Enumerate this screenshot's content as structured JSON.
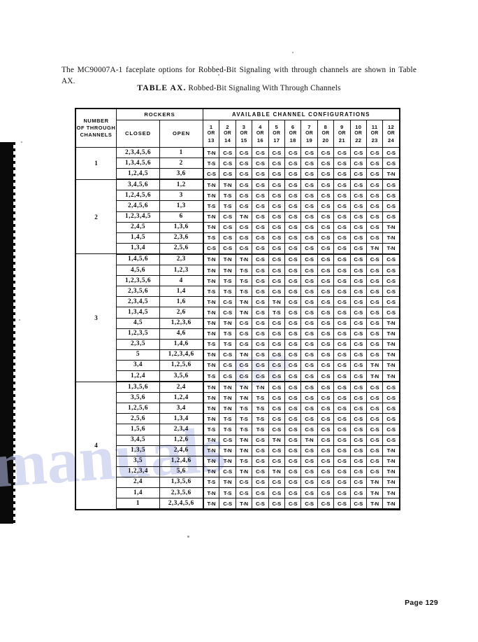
{
  "intro": {
    "text": "The MC90007A-1 faceplate options for Robbed-Bit Signaling with through channels are shown in Table AX."
  },
  "caption": {
    "label": "TABLE AX.",
    "text": "Robbed-Bit Signaling With Through Channels"
  },
  "table": {
    "headers": {
      "number_of_through_channels": "NUMBER OF THROUGH CHANNELS",
      "number_line1": "NUMBER",
      "number_line2": "OF  THROUGH",
      "number_line3": "CHANNELS",
      "rockers": "ROCKERS",
      "closed": "CLOSED",
      "open": "OPEN",
      "available_channel_configurations": "AVAILABLE CHANNEL CONFIGURATIONS",
      "or": "OR",
      "config_columns": [
        {
          "top": "1",
          "bottom": "13"
        },
        {
          "top": "2",
          "bottom": "14"
        },
        {
          "top": "3",
          "bottom": "15"
        },
        {
          "top": "4",
          "bottom": "16"
        },
        {
          "top": "5",
          "bottom": "17"
        },
        {
          "top": "6",
          "bottom": "18"
        },
        {
          "top": "7",
          "bottom": "19"
        },
        {
          "top": "8",
          "bottom": "20"
        },
        {
          "top": "9",
          "bottom": "21"
        },
        {
          "top": "10",
          "bottom": "22"
        },
        {
          "top": "11",
          "bottom": "23"
        },
        {
          "top": "12",
          "bottom": "24"
        }
      ]
    },
    "groups": [
      {
        "channels": "1",
        "rows": [
          {
            "closed": "2,3,4,5,6",
            "open": "1",
            "cfg": [
              "T-N",
              "C-S",
              "C-S",
              "C-S",
              "C-S",
              "C-S",
              "C-S",
              "C-S",
              "C-S",
              "C-S",
              "C-S",
              "C-S"
            ]
          },
          {
            "closed": "1,3,4,5,6",
            "open": "2",
            "cfg": [
              "T-S",
              "C-S",
              "C-S",
              "C-S",
              "C-S",
              "C-S",
              "C-S",
              "C-S",
              "C-S",
              "C-S",
              "C-S",
              "C-S"
            ]
          },
          {
            "closed": "1,2,4,5",
            "open": "3,6",
            "cfg": [
              "C-S",
              "C-S",
              "C-S",
              "C-S",
              "C-S",
              "C-S",
              "C-S",
              "C-S",
              "C-S",
              "C-S",
              "C-S",
              "T-N"
            ]
          }
        ]
      },
      {
        "channels": "2",
        "rows": [
          {
            "closed": "3,4,5,6",
            "open": "1,2",
            "cfg": [
              "T-N",
              "T-N",
              "C-S",
              "C-S",
              "C-S",
              "C-S",
              "C-S",
              "C-S",
              "C-S",
              "C-S",
              "C-S",
              "C-S"
            ]
          },
          {
            "closed": "1,2,4,5,6",
            "open": "3",
            "cfg": [
              "T-N",
              "T-S",
              "C-S",
              "C-S",
              "C-S",
              "C-S",
              "C-S",
              "C-S",
              "C-S",
              "C-S",
              "C-S",
              "C-S"
            ]
          },
          {
            "closed": "2,4,5,6",
            "open": "1,3",
            "cfg": [
              "T-S",
              "T-S",
              "C-S",
              "C-S",
              "C-S",
              "C-S",
              "C-S",
              "C-S",
              "C-S",
              "C-S",
              "C-S",
              "C-S"
            ]
          },
          {
            "closed": "1,2,3,4,5",
            "open": "6",
            "cfg": [
              "T-N",
              "C-S",
              "T-N",
              "C-S",
              "C-S",
              "C-S",
              "C-S",
              "C-S",
              "C-S",
              "C-S",
              "C-S",
              "C-S"
            ]
          },
          {
            "closed": "2,4,5",
            "open": "1,3,6",
            "cfg": [
              "T-N",
              "C-S",
              "C-S",
              "C-S",
              "C-S",
              "C-S",
              "C-S",
              "C-S",
              "C-S",
              "C-S",
              "C-S",
              "T-N"
            ]
          },
          {
            "closed": "1,4,5",
            "open": "2,3,6",
            "cfg": [
              "T-S",
              "C-S",
              "C-S",
              "C-S",
              "C-S",
              "C-S",
              "C-S",
              "C-S",
              "C-S",
              "C-S",
              "C-S",
              "T-N"
            ]
          },
          {
            "closed": "1,3,4",
            "open": "2,5,6",
            "cfg": [
              "C-S",
              "C-S",
              "C-S",
              "C-S",
              "C-S",
              "C-S",
              "C-S",
              "C-S",
              "C-S",
              "C-S",
              "T-N",
              "T-N"
            ]
          }
        ]
      },
      {
        "channels": "3",
        "rows": [
          {
            "closed": "1,4,5,6",
            "open": "2,3",
            "cfg": [
              "T-N",
              "T-N",
              "T-N",
              "C-S",
              "C-S",
              "C-S",
              "C-S",
              "C-S",
              "C-S",
              "C-S",
              "C-S",
              "C-S"
            ]
          },
          {
            "closed": "4,5,6",
            "open": "1,2,3",
            "cfg": [
              "T-N",
              "T-N",
              "T-S",
              "C-S",
              "C-S",
              "C-S",
              "C-S",
              "C-S",
              "C-S",
              "C-S",
              "C-S",
              "C-S"
            ]
          },
          {
            "closed": "1,2,3,5,6",
            "open": "4",
            "cfg": [
              "T-N",
              "T-S",
              "T-S",
              "C-S",
              "C-S",
              "C-S",
              "C-S",
              "C-S",
              "C-S",
              "C-S",
              "C-S",
              "C-S"
            ]
          },
          {
            "closed": "2,3,5,6",
            "open": "1,4",
            "cfg": [
              "T-S",
              "T-S",
              "T-S",
              "C-S",
              "C-S",
              "C-S",
              "C-S",
              "C-S",
              "C-S",
              "C-S",
              "C-S",
              "C-S"
            ]
          },
          {
            "closed": "2,3,4,5",
            "open": "1,6",
            "cfg": [
              "T-N",
              "C-S",
              "T-N",
              "C-S",
              "T-N",
              "C-S",
              "C-S",
              "C-S",
              "C-S",
              "C-S",
              "C-S",
              "C-S"
            ]
          },
          {
            "closed": "1,3,4,5",
            "open": "2,6",
            "cfg": [
              "T-N",
              "C-S",
              "T-N",
              "C-S",
              "T-S",
              "C-S",
              "C-S",
              "C-S",
              "C-S",
              "C-S",
              "C-S",
              "C-S"
            ]
          },
          {
            "closed": "4,5",
            "open": "1,2,3,6",
            "cfg": [
              "T-N",
              "T-N",
              "C-S",
              "C-S",
              "C-S",
              "C-S",
              "C-S",
              "C-S",
              "C-S",
              "C-S",
              "C-S",
              "T-N"
            ]
          },
          {
            "closed": "1,2,3,5",
            "open": "4,6",
            "cfg": [
              "T-N",
              "T-S",
              "C-S",
              "C-S",
              "C-S",
              "C-S",
              "C-S",
              "C-S",
              "C-S",
              "C-S",
              "C-S",
              "T-N"
            ]
          },
          {
            "closed": "2,3,5",
            "open": "1,4,6",
            "cfg": [
              "T-S",
              "T-S",
              "C-S",
              "C-S",
              "C-S",
              "C-S",
              "C-S",
              "C-S",
              "C-S",
              "C-S",
              "C-S",
              "T-N"
            ]
          },
          {
            "closed": "5",
            "open": "1,2,3,4,6",
            "cfg": [
              "T-N",
              "C-S",
              "T-N",
              "C-S",
              "C-S",
              "C-S",
              "C-S",
              "C-S",
              "C-S",
              "C-S",
              "C-S",
              "T-N"
            ]
          },
          {
            "closed": "3,4",
            "open": "1,2,5,6",
            "cfg": [
              "T-N",
              "C-S",
              "C-S",
              "C-S",
              "C-S",
              "C-S",
              "C-S",
              "C-S",
              "C-S",
              "C-S",
              "T-N",
              "T-N"
            ]
          },
          {
            "closed": "1,2,4",
            "open": "3,5,6",
            "cfg": [
              "T-S",
              "C-S",
              "C-S",
              "C-S",
              "C-S",
              "C-S",
              "C-S",
              "C-S",
              "C-S",
              "C-S",
              "T-N",
              "T-N"
            ]
          }
        ]
      },
      {
        "channels": "4",
        "rows": [
          {
            "closed": "1,3,5,6",
            "open": "2,4",
            "cfg": [
              "T-N",
              "T-N",
              "T-N",
              "T-N",
              "C-S",
              "C-S",
              "C-S",
              "C-S",
              "C-S",
              "C-S",
              "C-S",
              "C-S"
            ]
          },
          {
            "closed": "3,5,6",
            "open": "1,2,4",
            "cfg": [
              "T-N",
              "T-N",
              "T-N",
              "T-S",
              "C-S",
              "C-S",
              "C-S",
              "C-S",
              "C-S",
              "C-S",
              "C-S",
              "C-S"
            ]
          },
          {
            "closed": "1,2,5,6",
            "open": "3,4",
            "cfg": [
              "T-N",
              "T-N",
              "T-S",
              "T-S",
              "C-S",
              "C-S",
              "C-S",
              "C-S",
              "C-S",
              "C-S",
              "C-S",
              "C-S"
            ]
          },
          {
            "closed": "2,5,6",
            "open": "1,3,4",
            "cfg": [
              "T-N",
              "T-S",
              "T-S",
              "T-S",
              "C-S",
              "C-S",
              "C-S",
              "C-S",
              "C-S",
              "C-S",
              "C-S",
              "C-S"
            ]
          },
          {
            "closed": "1,5,6",
            "open": "2,3,4",
            "cfg": [
              "T-S",
              "T-S",
              "T-S",
              "T-S",
              "C-S",
              "C-S",
              "C-S",
              "C-S",
              "C-S",
              "C-S",
              "C-S",
              "C-S"
            ]
          },
          {
            "closed": "3,4,5",
            "open": "1,2,6",
            "cfg": [
              "T-N",
              "C-S",
              "T-N",
              "C-S",
              "T-N",
              "C-S",
              "T-N",
              "C-S",
              "C-S",
              "C-S",
              "C-S",
              "C-S"
            ]
          },
          {
            "closed": "1,3,5",
            "open": "2,4,6",
            "cfg": [
              "T-N",
              "T-N",
              "T-N",
              "C-S",
              "C-S",
              "C-S",
              "C-S",
              "C-S",
              "C-S",
              "C-S",
              "C-S",
              "T-N"
            ]
          },
          {
            "closed": "3,5",
            "open": "1,2,4,6",
            "cfg": [
              "T-N",
              "T-N",
              "T-S",
              "C-S",
              "C-S",
              "C-S",
              "C-S",
              "C-S",
              "C-S",
              "C-S",
              "C-S",
              "T-N"
            ]
          },
          {
            "closed": "1,2,3,4",
            "open": "5,6",
            "cfg": [
              "T-N",
              "C-S",
              "T-N",
              "C-S",
              "T-N",
              "C-S",
              "C-S",
              "C-S",
              "C-S",
              "C-S",
              "C-S",
              "T-N"
            ]
          },
          {
            "closed": "2,4",
            "open": "1,3,5,6",
            "cfg": [
              "T-S",
              "T-N",
              "C-S",
              "C-S",
              "C-S",
              "C-S",
              "C-S",
              "C-S",
              "C-S",
              "C-S",
              "T-N",
              "T-N"
            ]
          },
          {
            "closed": "1,4",
            "open": "2,3,5,6",
            "cfg": [
              "T-N",
              "T-S",
              "C-S",
              "C-S",
              "C-S",
              "C-S",
              "C-S",
              "C-S",
              "C-S",
              "C-S",
              "T-N",
              "T-N"
            ]
          },
          {
            "closed": "1",
            "open": "2,3,4,5,6",
            "cfg": [
              "T-N",
              "C-S",
              "T-N",
              "C-S",
              "C-S",
              "C-S",
              "C-S",
              "C-S",
              "C-S",
              "C-S",
              "T-N",
              "T-N"
            ]
          }
        ]
      }
    ]
  },
  "footer": {
    "page_label": "Page 129"
  }
}
